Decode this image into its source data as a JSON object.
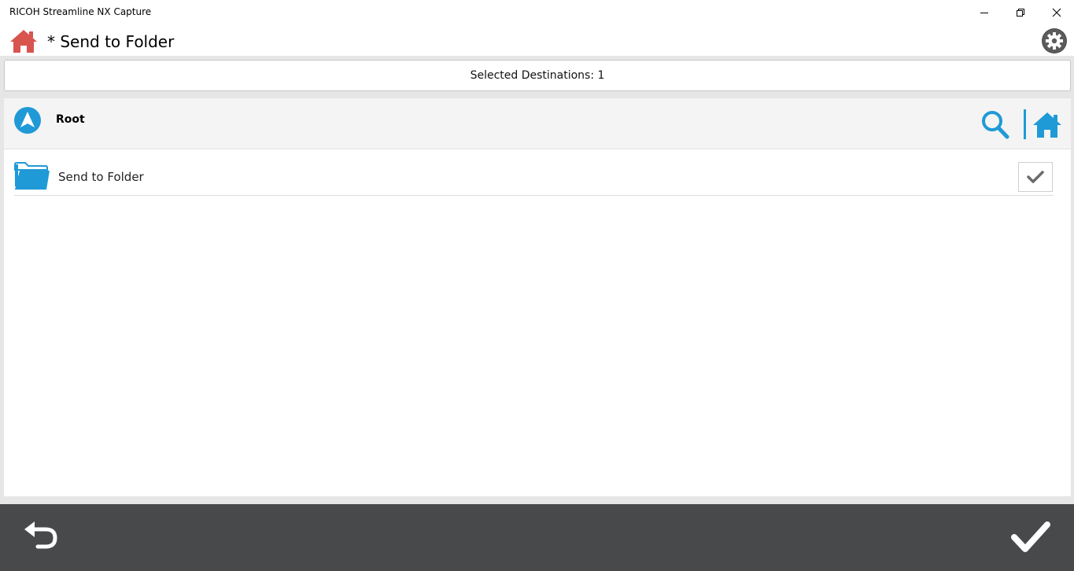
{
  "window": {
    "title": "RICOH Streamline NX Capture",
    "controls": [
      "minimize-icon",
      "restore-icon",
      "close-icon"
    ]
  },
  "header": {
    "title": "* Send to Folder",
    "home_icon": "home-icon",
    "settings_icon": "gear-icon"
  },
  "selection": {
    "label": "Selected Destinations: 1"
  },
  "navigation": {
    "current_location": "Root",
    "up_icon": "navigate-up-icon",
    "search_icon": "search-icon",
    "root_home_icon": "home-icon"
  },
  "items": [
    {
      "label": "Send to Folder",
      "icon": "folder-icon",
      "checked": true
    }
  ],
  "footer": {
    "back_icon": "back-arrow-icon",
    "ok_icon": "checkmark-icon"
  },
  "colors": {
    "accent": "#1f9ad6",
    "home_red": "#d9534f",
    "footer_bg": "#48494b",
    "panel_bg": "#e6e6e6"
  }
}
